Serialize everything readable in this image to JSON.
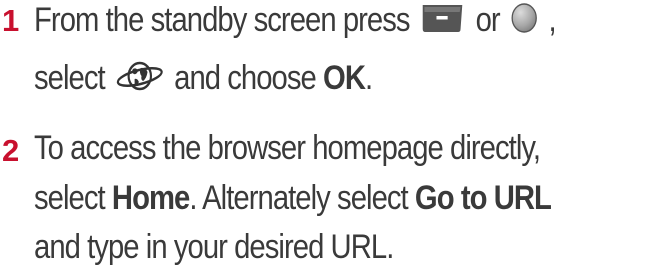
{
  "colors": {
    "step_number": "#c8102e",
    "text": "#3a3a3a"
  },
  "steps": [
    {
      "number": "1",
      "line1_a": "From the standby screen press",
      "line1_b": "or",
      "line1_c": ",",
      "line2_a": "select",
      "line2_b": "and choose",
      "line2_c": "OK",
      "line2_d": ".",
      "icons": [
        "soft-key-button-icon",
        "round-button-icon",
        "browser-globe-icon"
      ]
    },
    {
      "number": "2",
      "line1": "To access the browser homepage directly,",
      "line2_a": "select",
      "line2_b": "Home",
      "line2_c": ". Alternately select",
      "line2_d": "Go to URL",
      "line3": "and type in your desired URL."
    }
  ]
}
